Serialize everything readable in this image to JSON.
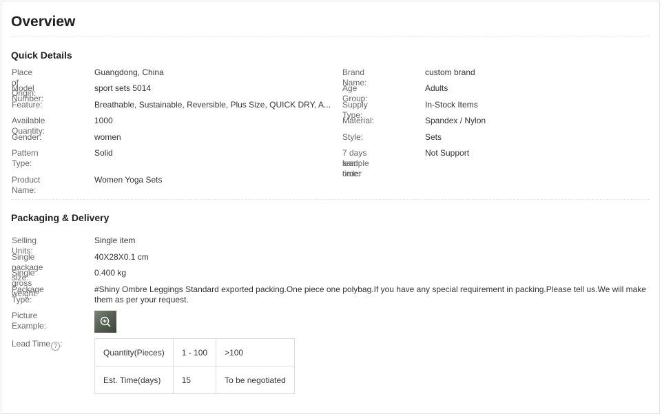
{
  "title": "Overview",
  "quick_details": {
    "heading": "Quick Details",
    "left": [
      {
        "label": "Place of Origin:",
        "value": "Guangdong, China"
      },
      {
        "label": "Model Number:",
        "value": "sport sets 5014"
      },
      {
        "label": "Feature:",
        "value": "Breathable, Sustainable, Reversible, Plus Size, QUICK DRY, A..."
      },
      {
        "label": "Available Quantity:",
        "value": "1000"
      },
      {
        "label": "Gender:",
        "value": "women"
      },
      {
        "label": "Pattern Type:",
        "value": "Solid"
      },
      {
        "label": "Product Name:",
        "value": "Women Yoga Sets"
      }
    ],
    "right": [
      {
        "label": "Brand Name:",
        "value": "custom brand"
      },
      {
        "label": "Age Group:",
        "value": "Adults"
      },
      {
        "label": "Supply Type:",
        "value": "In-Stock Items"
      },
      {
        "label": "Material:",
        "value": "Spandex / Nylon"
      },
      {
        "label": "Style:",
        "value": "Sets"
      },
      {
        "label_line1": "7 days sample order",
        "label_line2": "lead time:",
        "value": "Not Support"
      }
    ]
  },
  "packaging": {
    "heading": "Packaging & Delivery",
    "rows": [
      {
        "label": "Selling Units:",
        "value": "Single item"
      },
      {
        "label": "Single package size:",
        "value": "40X28X0.1 cm"
      },
      {
        "label": "Single gross weight:",
        "value": "0.400 kg"
      },
      {
        "label": "Package Type:",
        "value": "#Shiny Ombre Leggings Standard exported packing.One piece one polybag.If you have any special requirement in packing.Please tell us.We will make them as per your request."
      },
      {
        "label": "Picture Example:"
      }
    ],
    "lead_time": {
      "label": "Lead Time",
      "help": "?",
      "colon": ":",
      "rows": [
        [
          "Quantity(Pieces)",
          "1 - 100",
          ">100"
        ],
        [
          "Est. Time(days)",
          "15",
          "To be negotiated"
        ]
      ]
    }
  },
  "icons": {
    "picture_zoom": "zoom-in-icon",
    "help": "question-circle-icon"
  }
}
